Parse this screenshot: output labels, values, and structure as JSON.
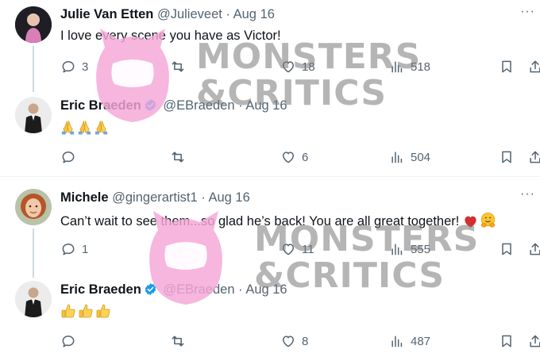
{
  "tweets": [
    {
      "name": "Julie Van Etten",
      "handle": "@Julieveet",
      "dot": "·",
      "date": "Aug 16",
      "text": "I love every scene you have as Victor!",
      "replies": "3",
      "retweets": "",
      "likes": "18",
      "views": "518"
    },
    {
      "name": "Eric Braeden",
      "handle": "@EBraeden",
      "dot": "·",
      "date": "Aug 16",
      "emojis": [
        "folded-hands",
        "folded-hands",
        "folded-hands"
      ],
      "replies": "",
      "retweets": "",
      "likes": "6",
      "views": "504"
    },
    {
      "name": "Michele",
      "handle": "@gingerartist1",
      "dot": "·",
      "date": "Aug 16",
      "text": "Can’t wait to see them...so glad he’s back! You are all great together!",
      "replies": "1",
      "retweets": "",
      "likes": "11",
      "views": "555"
    },
    {
      "name": "Eric Braeden",
      "handle": "@EBraeden",
      "dot": "·",
      "date": "Aug 16",
      "emojis": [
        "thumbs-up",
        "thumbs-up",
        "thumbs-up"
      ],
      "replies": "",
      "retweets": "",
      "likes": "8",
      "views": "487"
    }
  ],
  "watermark": {
    "line1": "MONSTERS",
    "line2": "&CRITICS"
  },
  "colors": {
    "text_primary": "#0f1419",
    "text_secondary": "#536471",
    "verified_blue": "#1d9bf0",
    "thread_line": "#cfd9de",
    "watermark_pink": "#f4a6d7",
    "heart_red": "#d32f2f"
  }
}
